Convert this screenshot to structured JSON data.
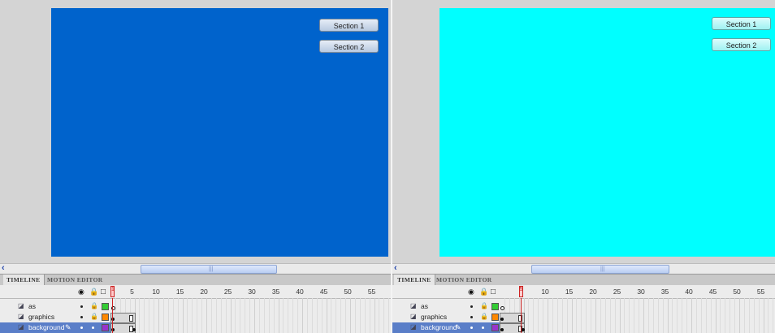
{
  "panels": [
    {
      "id": "left",
      "stage_color": "#0063cc",
      "button_style": "blue",
      "buttons": [
        "Section 1",
        "Section 2"
      ],
      "playhead_label": "1",
      "playhead_frame": 1
    },
    {
      "id": "right",
      "stage_color": "#00ffff",
      "button_style": "cyan",
      "buttons": [
        "Section 1",
        "Section 2"
      ],
      "playhead_label": "5",
      "playhead_frame": 5
    }
  ],
  "tabs": {
    "timeline": "TIMELINE",
    "motion_editor": "MOTION EDITOR"
  },
  "frame_numbers": [
    "5",
    "10",
    "15",
    "20",
    "25",
    "30",
    "35",
    "40",
    "45",
    "50",
    "55"
  ],
  "layers": [
    {
      "name": "as",
      "color": "#33cc33"
    },
    {
      "name": "graphics",
      "color": "#ff8800"
    },
    {
      "name": "background",
      "color": "#9933cc",
      "selected": true
    }
  ],
  "icons": {
    "eye": "eye-icon",
    "lock": "lock-icon",
    "outline": "outline-icon",
    "layer": "layer-icon",
    "pencil": "pencil-icon",
    "scroll_left": "arrow-left-icon"
  }
}
